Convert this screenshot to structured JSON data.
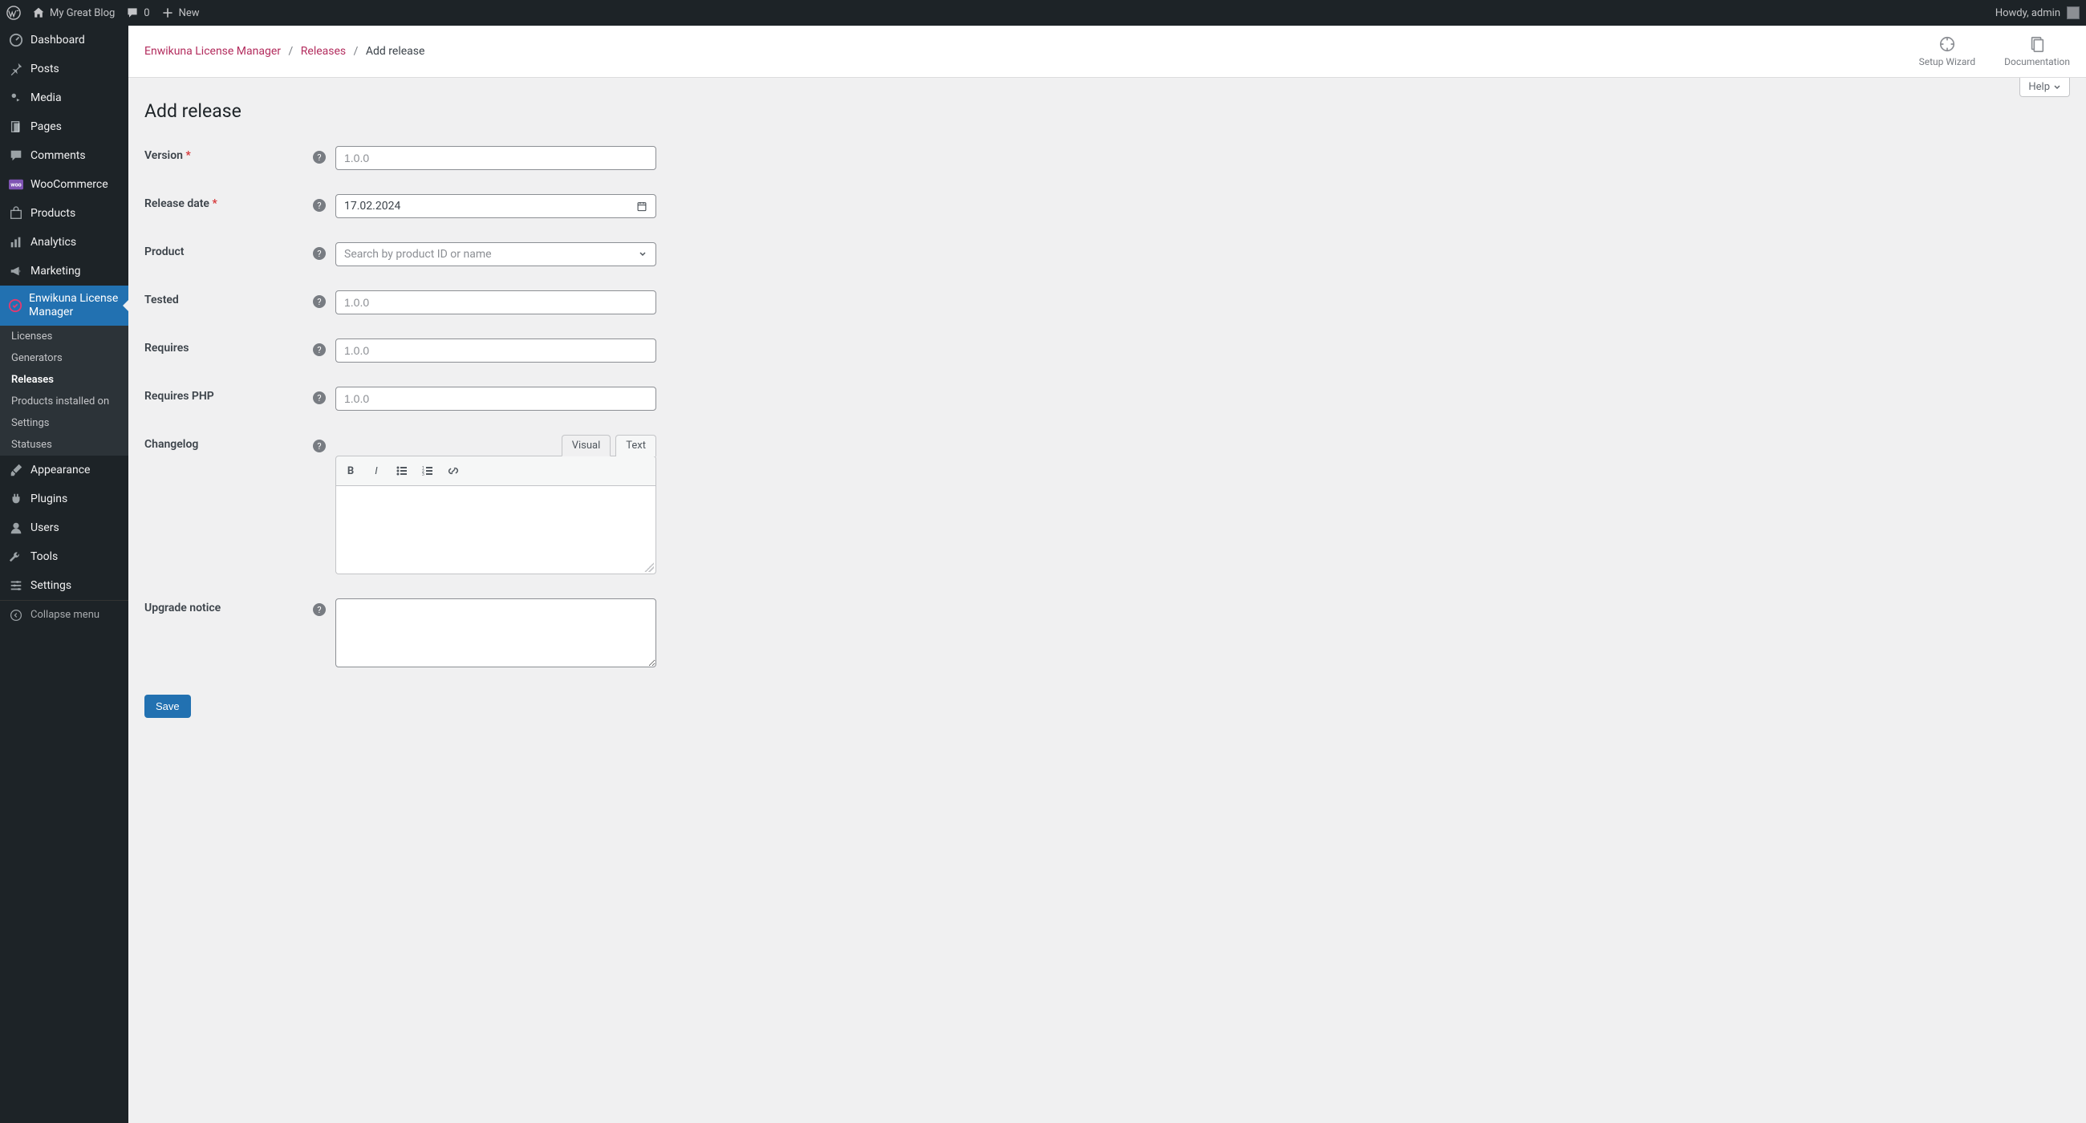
{
  "adminbar": {
    "site_name": "My Great Blog",
    "comments_count": "0",
    "new_label": "New",
    "howdy": "Howdy, admin"
  },
  "sidebar": {
    "items": [
      {
        "label": "Dashboard"
      },
      {
        "label": "Posts"
      },
      {
        "label": "Media"
      },
      {
        "label": "Pages"
      },
      {
        "label": "Comments"
      },
      {
        "label": "WooCommerce"
      },
      {
        "label": "Products"
      },
      {
        "label": "Analytics"
      },
      {
        "label": "Marketing"
      },
      {
        "label": "Enwikuna License Manager"
      },
      {
        "label": "Appearance"
      },
      {
        "label": "Plugins"
      },
      {
        "label": "Users"
      },
      {
        "label": "Tools"
      },
      {
        "label": "Settings"
      }
    ],
    "submenu": [
      {
        "label": "Licenses"
      },
      {
        "label": "Generators"
      },
      {
        "label": "Releases"
      },
      {
        "label": "Products installed on"
      },
      {
        "label": "Settings"
      },
      {
        "label": "Statuses"
      }
    ],
    "collapse_label": "Collapse menu"
  },
  "header": {
    "breadcrumb": {
      "root": "Enwikuna License Manager",
      "section": "Releases",
      "current": "Add release"
    },
    "setup_wizard": "Setup Wizard",
    "documentation": "Documentation",
    "help": "Help"
  },
  "page_title": "Add release",
  "form": {
    "version": {
      "label": "Version",
      "required": true,
      "placeholder": "1.0.0",
      "value": ""
    },
    "release_date": {
      "label": "Release date",
      "required": true,
      "value": "17.02.2024"
    },
    "product": {
      "label": "Product",
      "placeholder": "Search by product ID or name"
    },
    "tested": {
      "label": "Tested",
      "placeholder": "1.0.0",
      "value": ""
    },
    "requires": {
      "label": "Requires",
      "placeholder": "1.0.0",
      "value": ""
    },
    "requires_php": {
      "label": "Requires PHP",
      "placeholder": "1.0.0",
      "value": ""
    },
    "changelog": {
      "label": "Changelog",
      "tab_visual": "Visual",
      "tab_text": "Text"
    },
    "upgrade_notice": {
      "label": "Upgrade notice",
      "value": ""
    },
    "save": "Save"
  }
}
